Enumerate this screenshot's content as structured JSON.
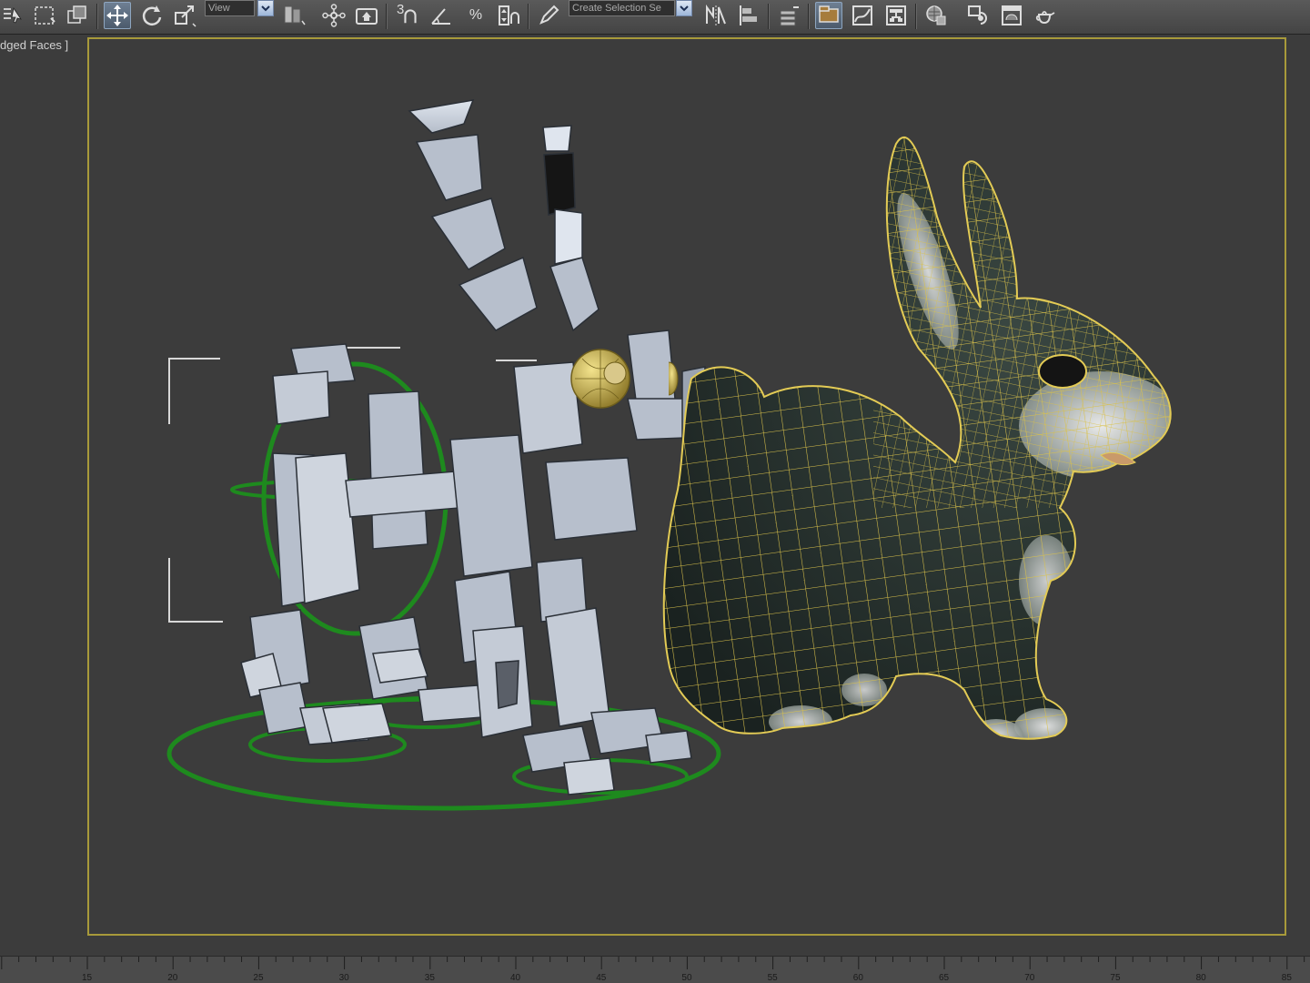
{
  "toolbar": {
    "reference_coord_value": "View",
    "named_selection_placeholder": "Create Selection Se",
    "spinner_snap_label": "3",
    "icons": [
      "select-by-name-icon",
      "rectangular-selection-icon",
      "window-crossing-icon",
      "select-move-icon",
      "select-rotate-icon",
      "select-scale-icon",
      "use-pivot-center-icon",
      "select-manipulate-icon",
      "keyboard-shortcut-icon",
      "snaps-toggle-icon",
      "angle-snap-icon",
      "percent-snap-icon",
      "spinner-snap-icon",
      "edit-named-selection-icon",
      "mirror-icon",
      "align-icon",
      "layer-manager-icon",
      "graphite-modeling-icon",
      "curve-editor-icon",
      "schematic-view-icon",
      "material-editor-icon",
      "render-setup-icon",
      "rendered-frame-icon",
      "render-teapot-icon"
    ]
  },
  "viewport": {
    "label": "dged Faces ]",
    "safe_frame_color": "#a89a3a",
    "background_color": "#3c3c3c",
    "objects": [
      "robot-rig",
      "rabbit-mesh"
    ]
  },
  "scene_colors": {
    "rig_boxes": "#b7bfcc",
    "rig_controls": "#1e8a1e",
    "rabbit_body": "#26302c",
    "rabbit_wire": "#d9c14a"
  },
  "ruler": {
    "ticks": [
      "15",
      "20",
      "25",
      "30",
      "35",
      "40",
      "45",
      "50",
      "55",
      "60",
      "65",
      "70",
      "75",
      "80",
      "85"
    ]
  }
}
